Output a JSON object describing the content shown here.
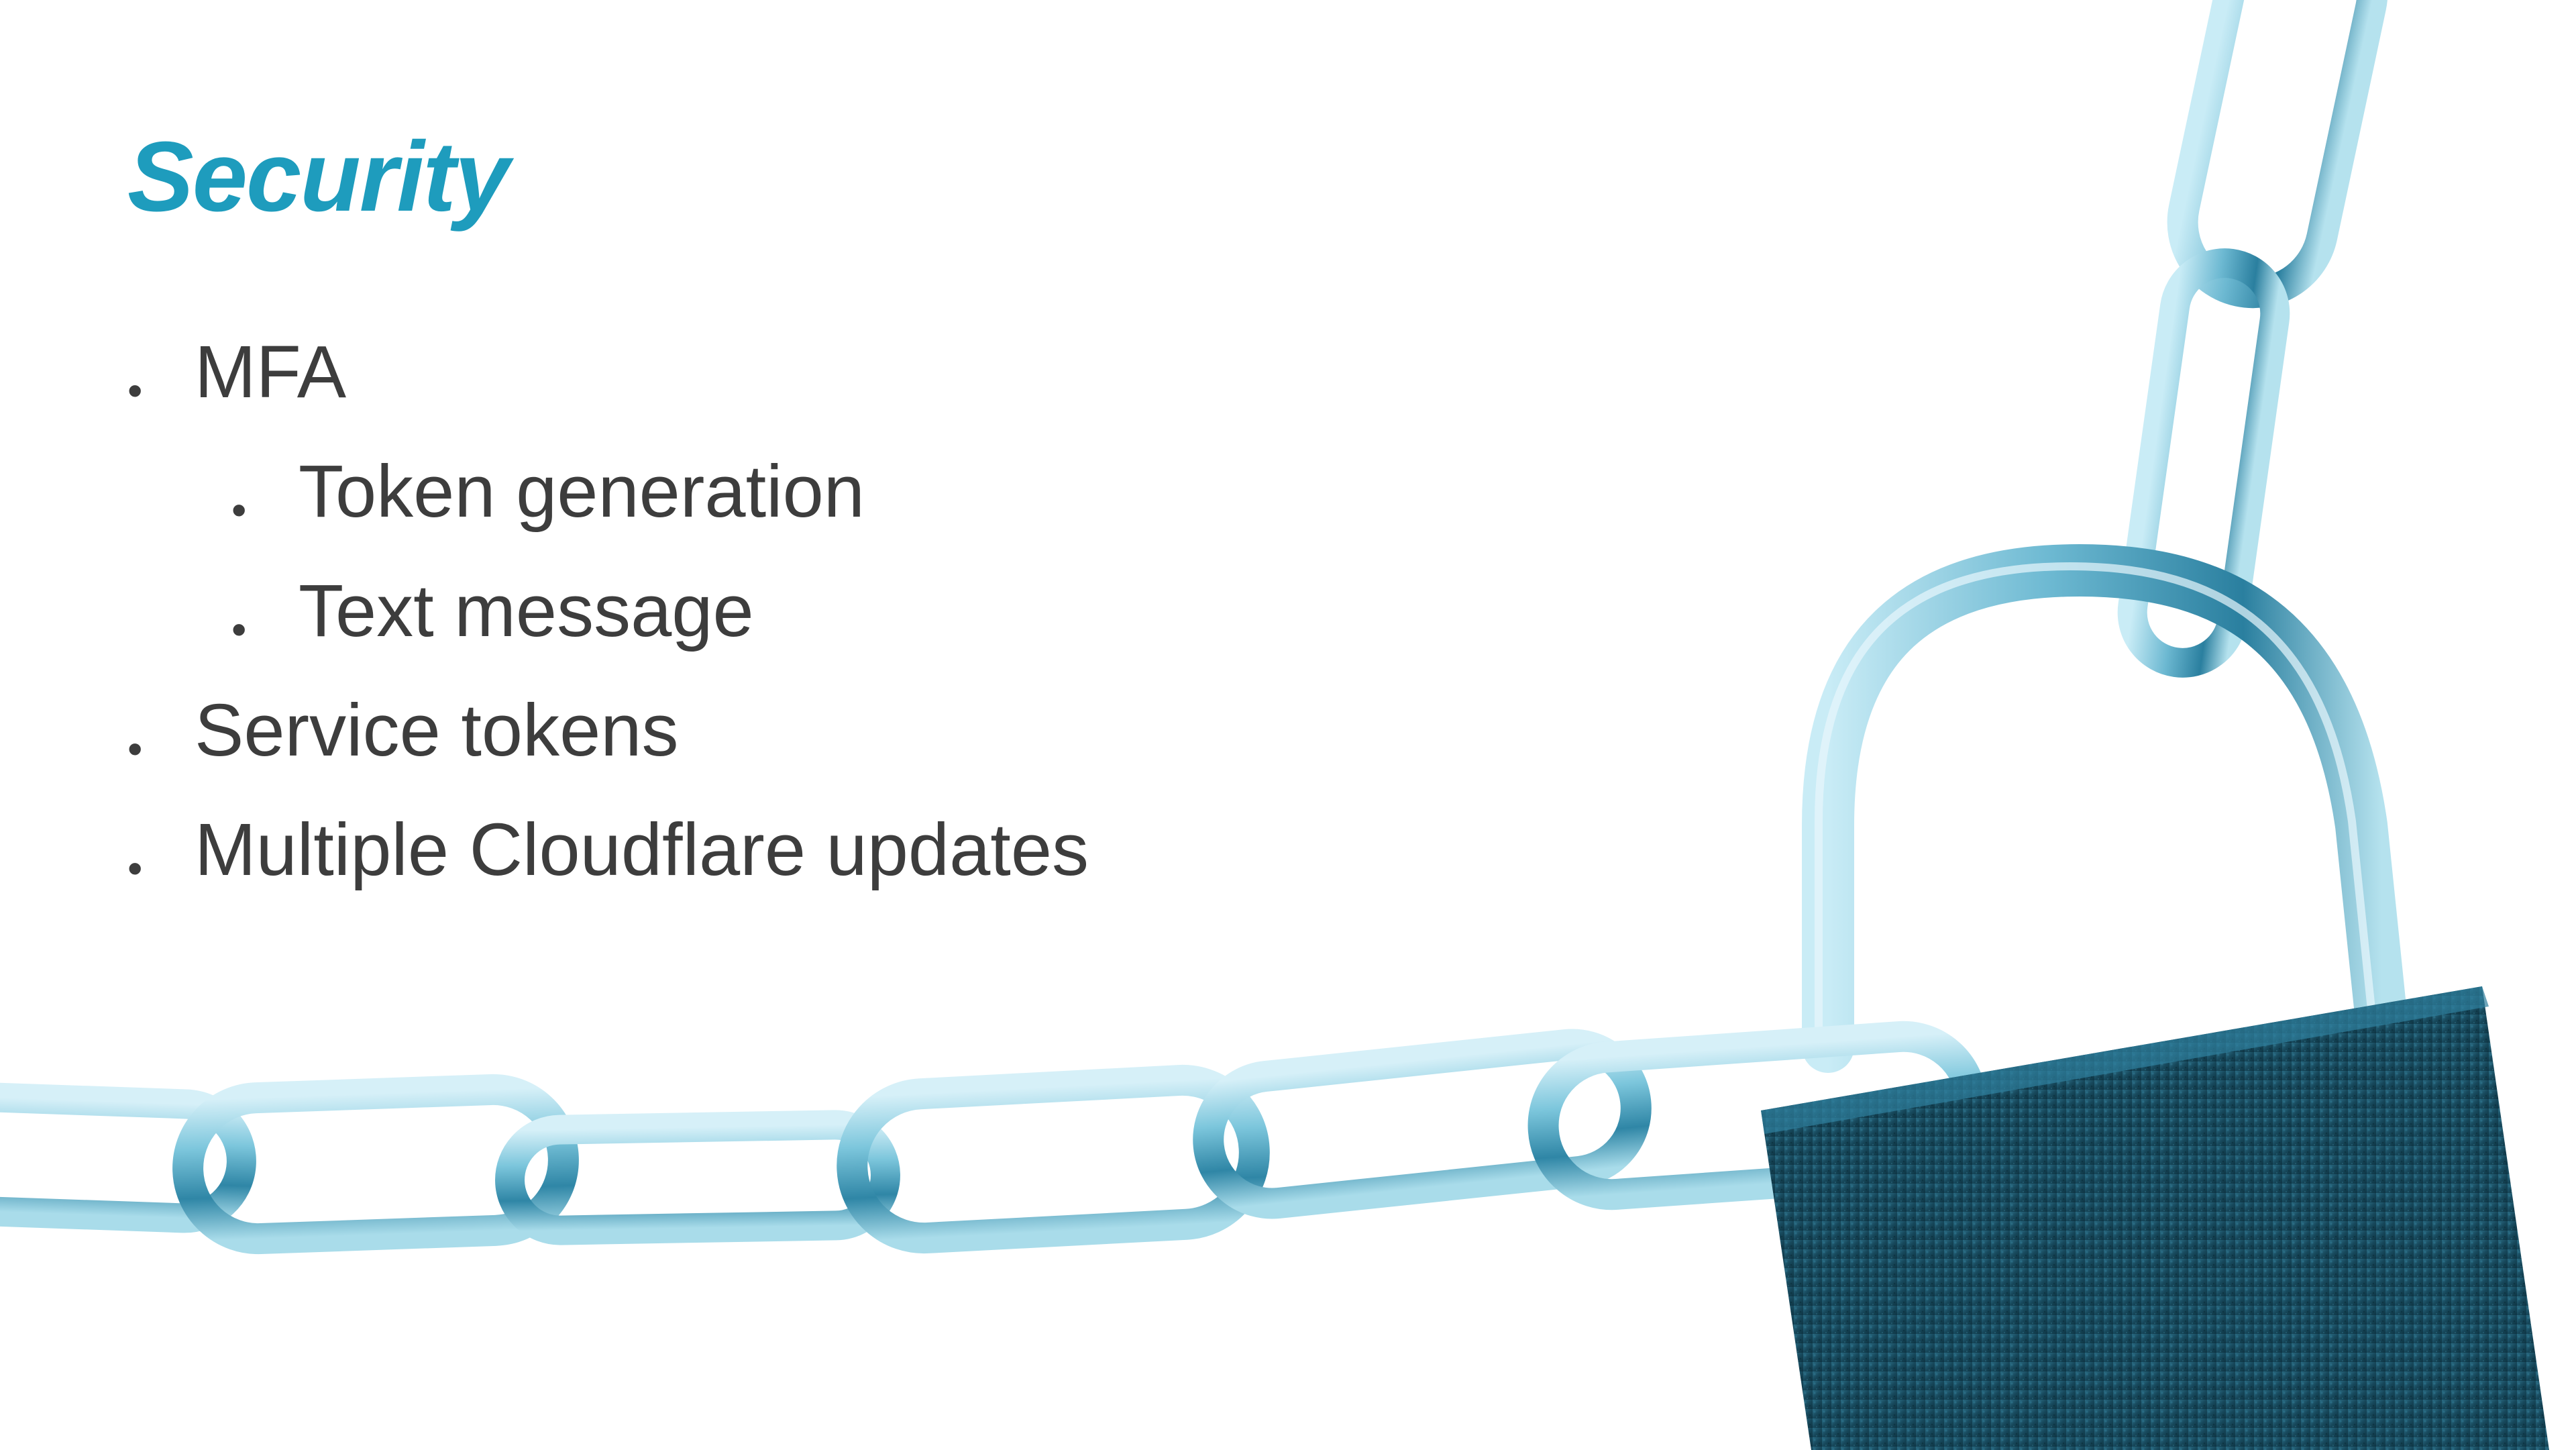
{
  "slide": {
    "title": "Security",
    "bullets": [
      {
        "text": "MFA",
        "level": 1
      },
      {
        "text": "Token generation",
        "level": 2
      },
      {
        "text": "Text message",
        "level": 2
      },
      {
        "text": "Service tokens",
        "level": 1
      },
      {
        "text": "Multiple Cloudflare updates",
        "level": 1
      }
    ],
    "bullet_glyph": "•",
    "image_subject": "padlock-and-chain",
    "colors": {
      "title": "#1e9cbd",
      "text": "#3d3d3d",
      "chain": "#5fb8d3",
      "lock_body": "#16485b",
      "background": "#ffffff"
    }
  }
}
